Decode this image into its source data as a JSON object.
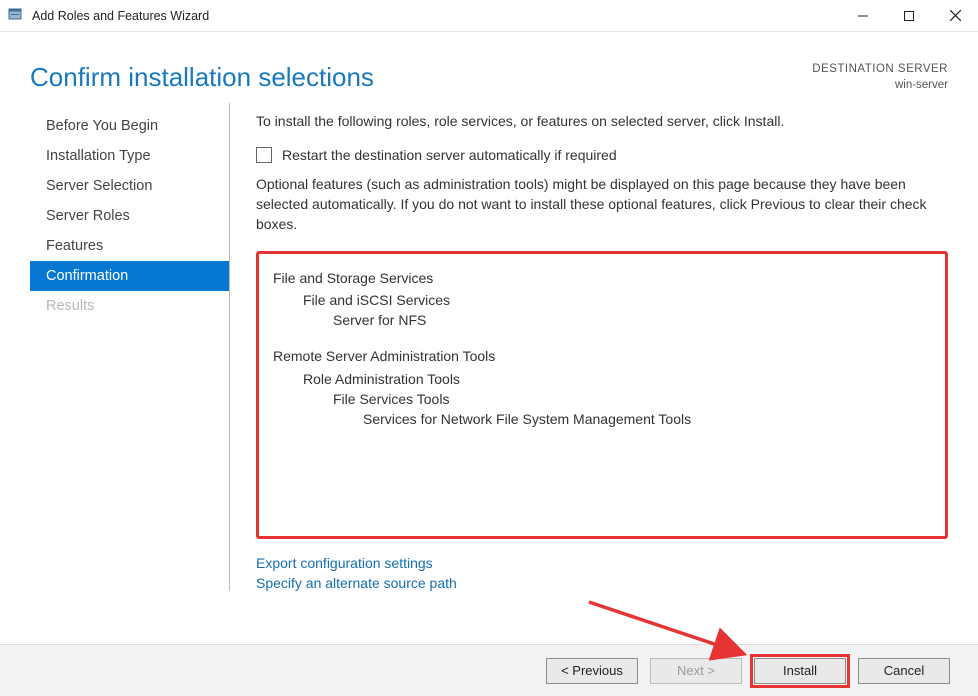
{
  "window": {
    "title": "Add Roles and Features Wizard"
  },
  "header": {
    "page_title": "Confirm installation selections",
    "dest_label": "DESTINATION SERVER",
    "dest_value": "win-server"
  },
  "nav": {
    "items": [
      {
        "label": "Before You Begin",
        "state": "normal"
      },
      {
        "label": "Installation Type",
        "state": "normal"
      },
      {
        "label": "Server Selection",
        "state": "normal"
      },
      {
        "label": "Server Roles",
        "state": "normal"
      },
      {
        "label": "Features",
        "state": "normal"
      },
      {
        "label": "Confirmation",
        "state": "active"
      },
      {
        "label": "Results",
        "state": "disabled"
      }
    ]
  },
  "content": {
    "instruction": "To install the following roles, role services, or features on selected server, click Install.",
    "restart_label": "Restart the destination server automatically if required",
    "restart_checked": false,
    "optional_note": "Optional features (such as administration tools) might be displayed on this page because they have been selected automatically. If you do not want to install these optional features, click Previous to clear their check boxes.",
    "selections": [
      {
        "text": "File and Storage Services",
        "level": 0
      },
      {
        "text": "File and iSCSI Services",
        "level": 1
      },
      {
        "text": "Server for NFS",
        "level": 2
      },
      {
        "text": "Remote Server Administration Tools",
        "level": 0,
        "gap_before": true
      },
      {
        "text": "Role Administration Tools",
        "level": 1
      },
      {
        "text": "File Services Tools",
        "level": 2
      },
      {
        "text": "Services for Network File System Management Tools",
        "level": 3
      }
    ],
    "link_export": "Export configuration settings",
    "link_path": "Specify an alternate source path"
  },
  "footer": {
    "previous": "< Previous",
    "next": "Next >",
    "install": "Install",
    "cancel": "Cancel"
  }
}
